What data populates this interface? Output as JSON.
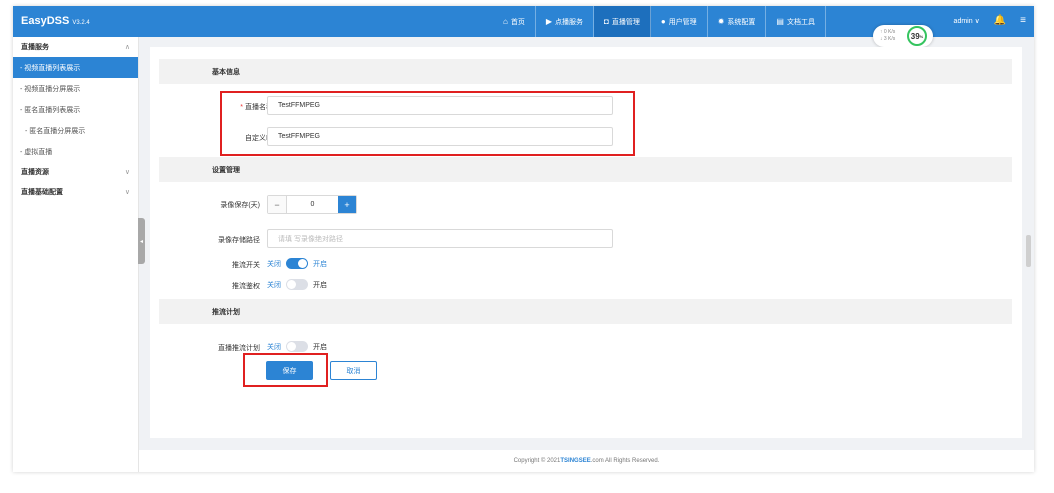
{
  "app": {
    "name": "EasyDSS",
    "version": "V3.2.4"
  },
  "nav": [
    {
      "label": "首页",
      "icon": "dashboard-icon",
      "active": false
    },
    {
      "label": "点播服务",
      "icon": "video-icon",
      "active": false
    },
    {
      "label": "直播管理",
      "icon": "live-icon",
      "active": true
    },
    {
      "label": "用户管理",
      "icon": "user-icon",
      "active": false
    },
    {
      "label": "系统配置",
      "icon": "gear-icon",
      "active": false
    },
    {
      "label": "文档工具",
      "icon": "document-icon",
      "active": false
    }
  ],
  "user": {
    "name": "admin",
    "caret": "∨"
  },
  "gauge": {
    "up": "0 K/s",
    "down": "3 K/s",
    "percent": "39",
    "unit": "%"
  },
  "sidebar": {
    "group1": {
      "label": "直播服务",
      "chevron": "∧"
    },
    "items": [
      {
        "label": "- 视频直播列表展示",
        "active": true
      },
      {
        "label": "- 视频直播分屏展示",
        "active": false
      },
      {
        "label": "- 匿名直播列表展示",
        "active": false
      },
      {
        "label": "- 匿名直播分屏展示",
        "active": false
      },
      {
        "label": "- 虚拟直播",
        "active": false
      }
    ],
    "group2": {
      "label": "直播资源",
      "chevron": "∨"
    },
    "group3": {
      "label": "直播基础配置",
      "chevron": "∨"
    }
  },
  "form": {
    "section_basic": "基本信息",
    "name_label": "直播名称",
    "name_required": "*",
    "name_value": "TestFFMPEG",
    "custom_id_label": "自定义ID",
    "custom_id_value": "TestFFMPEG",
    "section_settings": "设置管理",
    "record_days_label": "录像保存(天)",
    "record_days_value": "0",
    "minus": "−",
    "plus": "+",
    "record_path_label": "录像存储路径",
    "record_path_placeholder": "请填 写录像绝对路径",
    "push_switch_label": "推流开关",
    "push_auth_label": "推流鉴权",
    "off_text": "关闭",
    "on_text": "开启",
    "section_plan": "推流计划",
    "plan_label": "直播推流计划",
    "save_label": "保存",
    "cancel_label": "取消"
  },
  "toggles": {
    "push_switch": true,
    "push_auth": false,
    "plan": false
  },
  "footer": {
    "prefix": "Copyright © 2021 ",
    "brand": "TSINGSEE",
    "suffix": ".com All Rights Reserved."
  },
  "colors": {
    "accent": "#2c84d4",
    "highlight": "#e02020"
  }
}
